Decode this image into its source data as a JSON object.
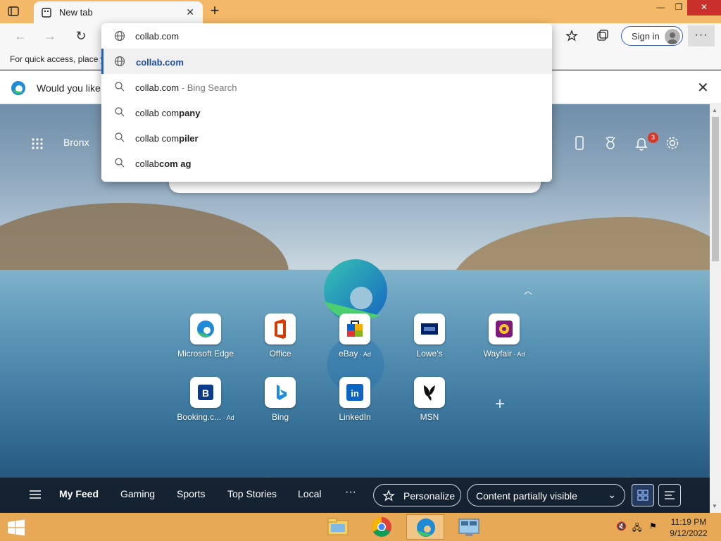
{
  "browser": {
    "tab_title": "New tab",
    "address_value": "collab.com",
    "signin_label": "Sign in",
    "favorites_bar_text": "For quick access, place y",
    "info_bar_text": "Would you like t"
  },
  "dropdown": {
    "rows": [
      {
        "icon": "globe-icon",
        "text": "collab.com",
        "type": "link"
      },
      {
        "icon": "search-icon",
        "query": "collab.com",
        "suffix": " - Bing Search"
      },
      {
        "icon": "search-icon",
        "plain": "collab com",
        "bold": "pany"
      },
      {
        "icon": "search-icon",
        "plain": "collab com",
        "bold": "piler"
      },
      {
        "icon": "search-icon",
        "plain": "collab",
        "bold": "com ag"
      }
    ]
  },
  "newtab": {
    "location": "Bronx",
    "notification_count": "3",
    "tiles_row1": [
      {
        "label": "Microsoft Edge",
        "ad": ""
      },
      {
        "label": "Office",
        "ad": ""
      },
      {
        "label": "eBay",
        "ad": " · Ad"
      },
      {
        "label": "Lowe's",
        "ad": ""
      },
      {
        "label": "Wayfair",
        "ad": " · Ad"
      }
    ],
    "tiles_row2": [
      {
        "label": "Booking.c...",
        "ad": " · Ad"
      },
      {
        "label": "Bing",
        "ad": ""
      },
      {
        "label": "LinkedIn",
        "ad": ""
      },
      {
        "label": "MSN",
        "ad": ""
      }
    ],
    "feed_tabs": [
      "My Feed",
      "Gaming",
      "Sports",
      "Top Stories",
      "Local"
    ],
    "feed_more": "···",
    "personalize_label": "Personalize",
    "content_visibility": "Content partially visible"
  },
  "taskbar": {
    "time": "11:19 PM",
    "date": "9/12/2022"
  },
  "colors": {
    "titlebar": "#f4b869",
    "taskbar": "#e8a956",
    "accent": "#2c5fb0"
  }
}
